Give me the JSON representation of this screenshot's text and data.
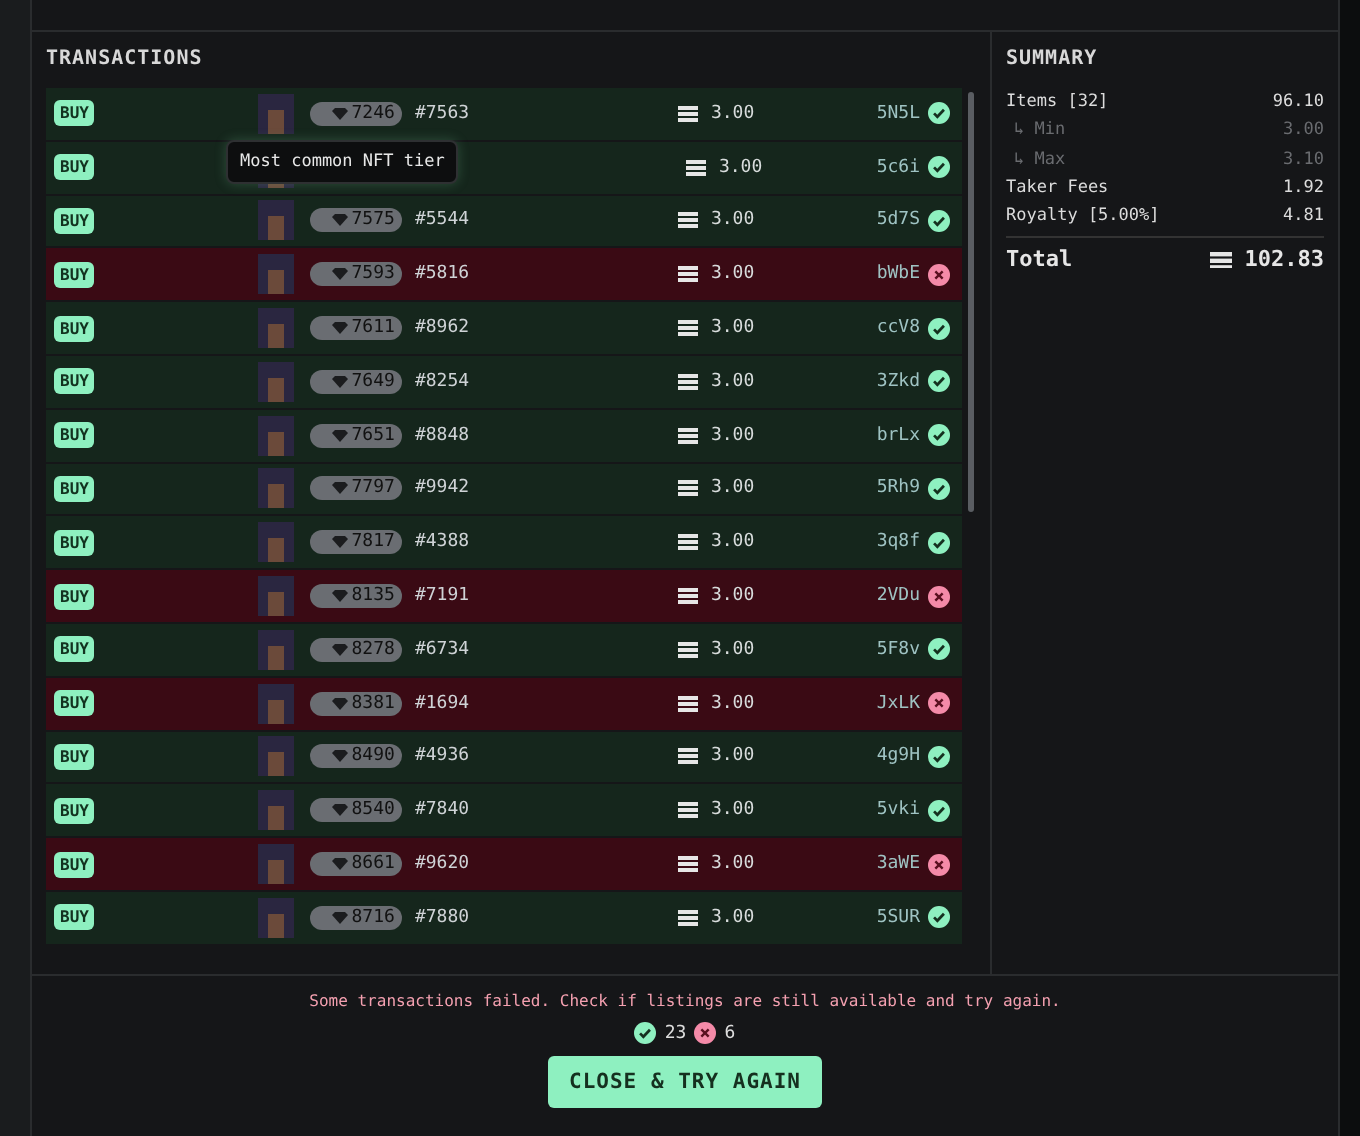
{
  "transactions": {
    "title": "TRANSACTIONS",
    "rows": [
      {
        "action": "BUY",
        "rank": "7246",
        "mint": "#7563",
        "price": "3.00",
        "signature": "5N5L",
        "failed": false
      },
      {
        "action": "BUY",
        "price": "3.00",
        "signature": "5c6i",
        "failed": false,
        "tooltip": "Most common NFT tier"
      },
      {
        "action": "BUY",
        "rank": "7575",
        "mint": "#5544",
        "price": "3.00",
        "signature": "5d7S",
        "failed": false
      },
      {
        "action": "BUY",
        "rank": "7593",
        "mint": "#5816",
        "price": "3.00",
        "signature": "bWbE",
        "failed": true
      },
      {
        "action": "BUY",
        "rank": "7611",
        "mint": "#8962",
        "price": "3.00",
        "signature": "ccV8",
        "failed": false
      },
      {
        "action": "BUY",
        "rank": "7649",
        "mint": "#8254",
        "price": "3.00",
        "signature": "3Zkd",
        "failed": false
      },
      {
        "action": "BUY",
        "rank": "7651",
        "mint": "#8848",
        "price": "3.00",
        "signature": "brLx",
        "failed": false
      },
      {
        "action": "BUY",
        "rank": "7797",
        "mint": "#9942",
        "price": "3.00",
        "signature": "5Rh9",
        "failed": false
      },
      {
        "action": "BUY",
        "rank": "7817",
        "mint": "#4388",
        "price": "3.00",
        "signature": "3q8f",
        "failed": false
      },
      {
        "action": "BUY",
        "rank": "8135",
        "mint": "#7191",
        "price": "3.00",
        "signature": "2VDu",
        "failed": true
      },
      {
        "action": "BUY",
        "rank": "8278",
        "mint": "#6734",
        "price": "3.00",
        "signature": "5F8v",
        "failed": false
      },
      {
        "action": "BUY",
        "rank": "8381",
        "mint": "#1694",
        "price": "3.00",
        "signature": "JxLK",
        "failed": true
      },
      {
        "action": "BUY",
        "rank": "8490",
        "mint": "#4936",
        "price": "3.00",
        "signature": "4g9H",
        "failed": false
      },
      {
        "action": "BUY",
        "rank": "8540",
        "mint": "#7840",
        "price": "3.00",
        "signature": "5vki",
        "failed": false
      },
      {
        "action": "BUY",
        "rank": "8661",
        "mint": "#9620",
        "price": "3.00",
        "signature": "3aWE",
        "failed": true
      },
      {
        "action": "BUY",
        "rank": "8716",
        "mint": "#7880",
        "price": "3.00",
        "signature": "5SUR",
        "failed": false
      }
    ]
  },
  "summary": {
    "title": "SUMMARY",
    "lines": [
      {
        "kind": "main",
        "label": "Items [32]",
        "value": "96.10"
      },
      {
        "kind": "sub",
        "label": "↳ Min",
        "value": "3.00"
      },
      {
        "kind": "sub",
        "label": "↳ Max",
        "value": "3.10"
      },
      {
        "kind": "main",
        "label": "Taker Fees",
        "value": "1.92"
      },
      {
        "kind": "main",
        "label": "Royalty [5.00%]",
        "value": "4.81"
      }
    ],
    "total_label": "Total",
    "total_value": "102.83"
  },
  "footer": {
    "message": "Some transactions failed. Check if listings are still available and try again.",
    "success_count": "23",
    "failed_count": "6",
    "button": "CLOSE & TRY AGAIN"
  }
}
